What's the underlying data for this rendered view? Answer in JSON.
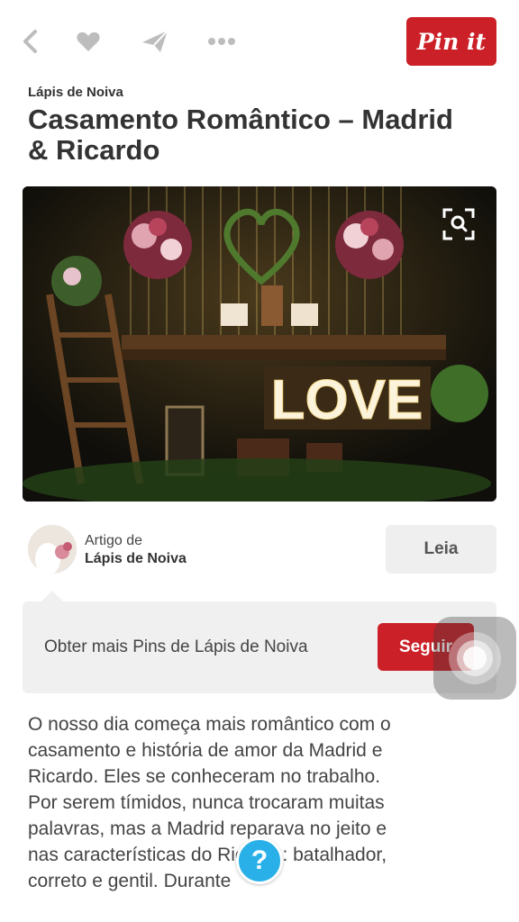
{
  "toolbar": {
    "back_icon": "chevron-left-icon",
    "like_icon": "heart-icon",
    "send_icon": "send-icon",
    "more_icon": "more-horizontal-icon",
    "pin_label": "Pin it",
    "accent_color": "#cb2027"
  },
  "article": {
    "source": "Lápis de Noiva",
    "title": "Casamento Romântico – Madrid & Ricardo"
  },
  "hero": {
    "sign_text": "LOVE",
    "zoom_icon": "visual-search-icon"
  },
  "author": {
    "by_label": "Artigo de",
    "name": "Lápis de Noiva",
    "read_label": "Leia"
  },
  "follow": {
    "text": "Obter mais Pins de Lápis de Noiva",
    "button_label": "Seguir"
  },
  "body": {
    "text": "O nosso dia começa mais romântico com o casamento e história de amor da Madrid e Ricardo. Eles se conheceram no trabalho. Por serem tímidos, nunca trocaram muitas palavras, mas a Madrid reparava no jeito e nas características do Ricardo: batalhador, correto e gentil. Durante"
  },
  "help": {
    "label": "?",
    "color": "#2ab0e8"
  }
}
